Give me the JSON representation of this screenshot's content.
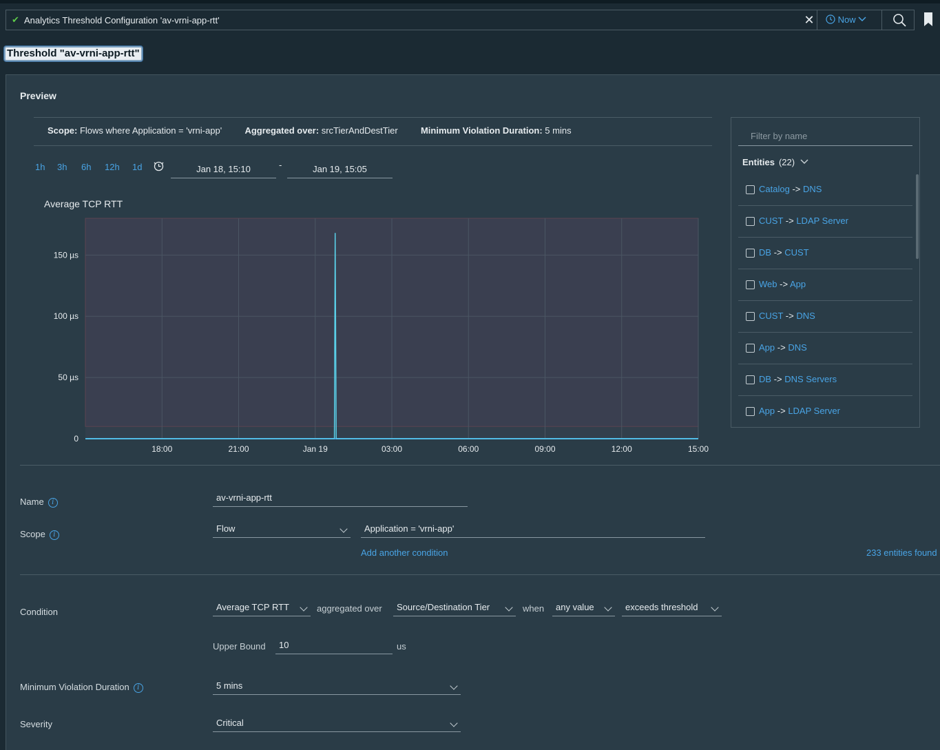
{
  "searchbar": {
    "status_icon": "check-icon",
    "query": "Analytics Threshold Configuration 'av-vrni-app-rtt'",
    "time_label": "Now"
  },
  "page": {
    "title": "Threshold \"av-vrni-app-rtt\""
  },
  "preview": {
    "label": "Preview",
    "scope_label": "Scope:",
    "scope_value": "Flows where Application = 'vrni-app'",
    "aggregated_label": "Aggregated over:",
    "aggregated_value": "srcTierAndDestTier",
    "min_violation_label": "Minimum Violation Duration:",
    "min_violation_value": "5 mins",
    "ranges": [
      "1h",
      "3h",
      "6h",
      "12h",
      "1d"
    ],
    "date_from": "Jan 18, 15:10",
    "date_sep": "-",
    "date_to": "Jan 19, 15:05"
  },
  "chart_data": {
    "type": "line",
    "title": "Average TCP RTT",
    "x_ticks": [
      "18:00",
      "21:00",
      "Jan 19",
      "03:00",
      "06:00",
      "09:00",
      "12:00",
      "15:00"
    ],
    "y_ticks": [
      "0",
      "50 µs",
      "100 µs",
      "150 µs"
    ],
    "ylim": [
      0,
      180
    ],
    "x_range_hours": [
      0,
      24
    ],
    "threshold_band": [
      10,
      180
    ],
    "series": [
      {
        "points": [
          [
            0,
            0
          ],
          [
            9.75,
            0
          ],
          [
            9.78,
            168
          ],
          [
            9.82,
            0
          ],
          [
            24,
            0
          ]
        ]
      }
    ],
    "colors": {
      "line": "#5ad0e8",
      "baseline": "#3b7ee0"
    }
  },
  "entities": {
    "filter_placeholder": "Filter by name",
    "title": "Entities",
    "count": "(22)",
    "items": [
      {
        "src": "Catalog",
        "dst": "DNS"
      },
      {
        "src": "CUST",
        "dst": "LDAP Server"
      },
      {
        "src": "DB",
        "dst": "CUST"
      },
      {
        "src": "Web",
        "dst": "App"
      },
      {
        "src": "CUST",
        "dst": "DNS"
      },
      {
        "src": "App",
        "dst": "DNS"
      },
      {
        "src": "DB",
        "dst": "DNS Servers"
      },
      {
        "src": "App",
        "dst": "LDAP Server"
      }
    ],
    "arrow": "->"
  },
  "form": {
    "name_label": "Name",
    "name_value": "av-vrni-app-rtt",
    "scope_label": "Scope",
    "scope_type": "Flow",
    "scope_condition": "Application = 'vrni-app'",
    "add_condition": "Add another condition",
    "entities_found": "233 entities found",
    "condition_label": "Condition",
    "metric": "Average TCP RTT",
    "aggregated_over_text": "aggregated over",
    "aggregation": "Source/Destination Tier",
    "when_text": "when",
    "value_mode": "any value",
    "comparison": "exceeds threshold",
    "upper_bound_label": "Upper Bound",
    "upper_bound_value": "10",
    "upper_bound_unit": "us",
    "min_duration_label": "Minimum Violation Duration",
    "min_duration_value": "5 mins",
    "severity_label": "Severity",
    "severity_value": "Critical"
  }
}
